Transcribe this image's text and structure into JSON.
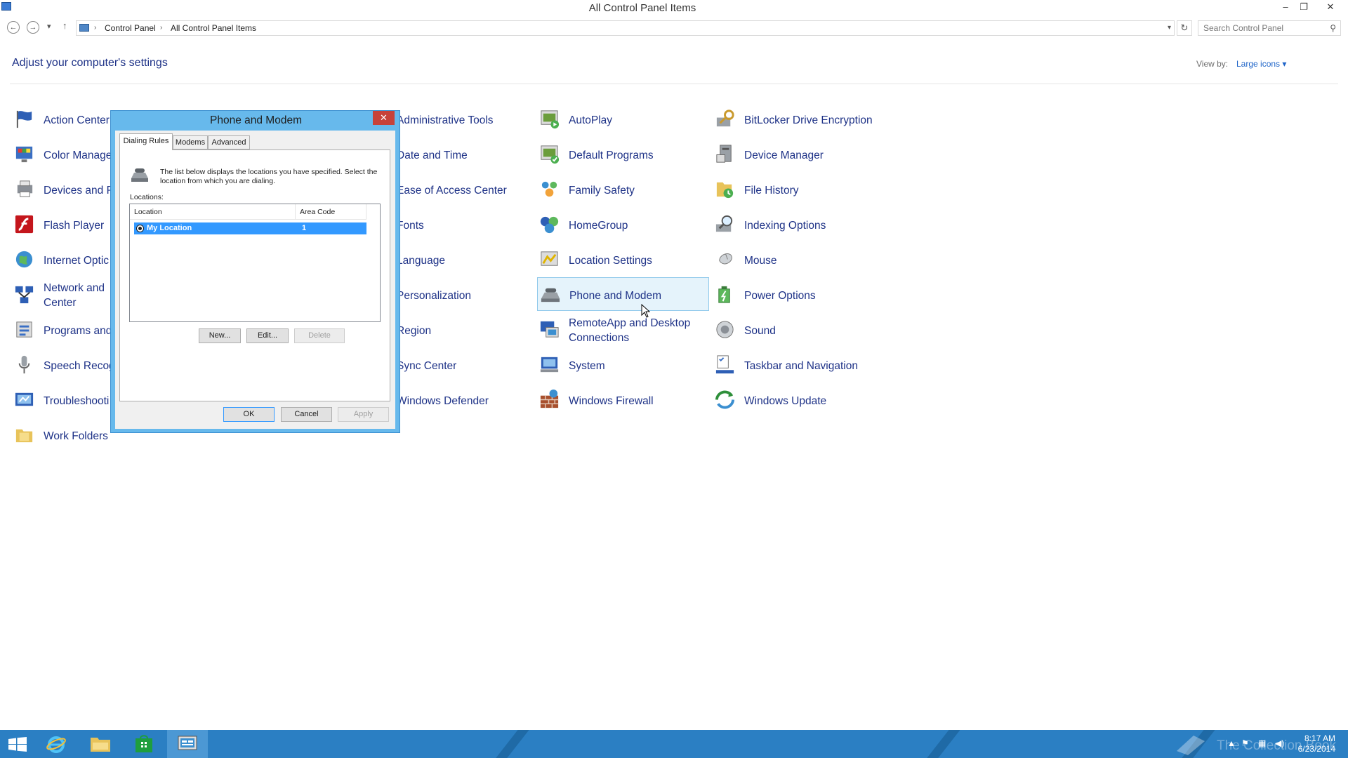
{
  "window": {
    "title": "All Control Panel Items",
    "minimize": "–",
    "restore": "❐",
    "close": "✕"
  },
  "nav": {
    "back": "←",
    "forward": "→",
    "recent": "▾",
    "up": "↑"
  },
  "address": {
    "crumbs": [
      "Control Panel",
      "All Control Panel Items"
    ],
    "separator": "›",
    "dropdown": "▾",
    "refresh": "↻"
  },
  "search": {
    "placeholder": "Search Control Panel",
    "icon": "⚲"
  },
  "header": {
    "title": "Adjust your computer's settings",
    "view_by_label": "View by:",
    "view_by_value": "Large icons ▾"
  },
  "items": {
    "col1": [
      "Action Center",
      "Color Manage",
      "Devices and P",
      "Flash Player",
      "Internet Optic",
      "Network and\nCenter",
      "Programs and",
      "Speech Recog",
      "Troubleshooti",
      "Work Folders"
    ],
    "col3": [
      "Administrative Tools",
      "Date and Time",
      "Ease of Access Center",
      "Fonts",
      "Language",
      "Personalization",
      "Region",
      "Sync Center",
      "Windows Defender"
    ],
    "col4": [
      "AutoPlay",
      "Default Programs",
      "Family Safety",
      "HomeGroup",
      "Location Settings",
      "Phone and Modem",
      "RemoteApp and Desktop Connections",
      "System",
      "Windows Firewall"
    ],
    "col5": [
      "BitLocker Drive Encryption",
      "Device Manager",
      "File History",
      "Indexing Options",
      "Mouse",
      "Power Options",
      "Sound",
      "Taskbar and Navigation",
      "Windows Update"
    ]
  },
  "dialog": {
    "title": "Phone and Modem",
    "close": "✕",
    "tabs": [
      "Dialing Rules",
      "Modems",
      "Advanced"
    ],
    "description": "The list below displays the locations you have specified. Select the location from which you are dialing.",
    "locations_label": "Locations:",
    "columns": [
      "Location",
      "Area Code"
    ],
    "rows": [
      {
        "location": "My Location",
        "area_code": "1"
      }
    ],
    "buttons": {
      "new": "New...",
      "edit": "Edit...",
      "delete": "Delete",
      "ok": "OK",
      "cancel": "Cancel",
      "apply": "Apply"
    }
  },
  "taskbar": {
    "time": "8:17 AM",
    "date": "6/23/2014",
    "watermark": "The Collection Book"
  },
  "colors": {
    "link": "#1e3287",
    "taskbar": "#2b7fc3",
    "dialog_frame": "#67b9ec",
    "selection": "#3399ff"
  }
}
